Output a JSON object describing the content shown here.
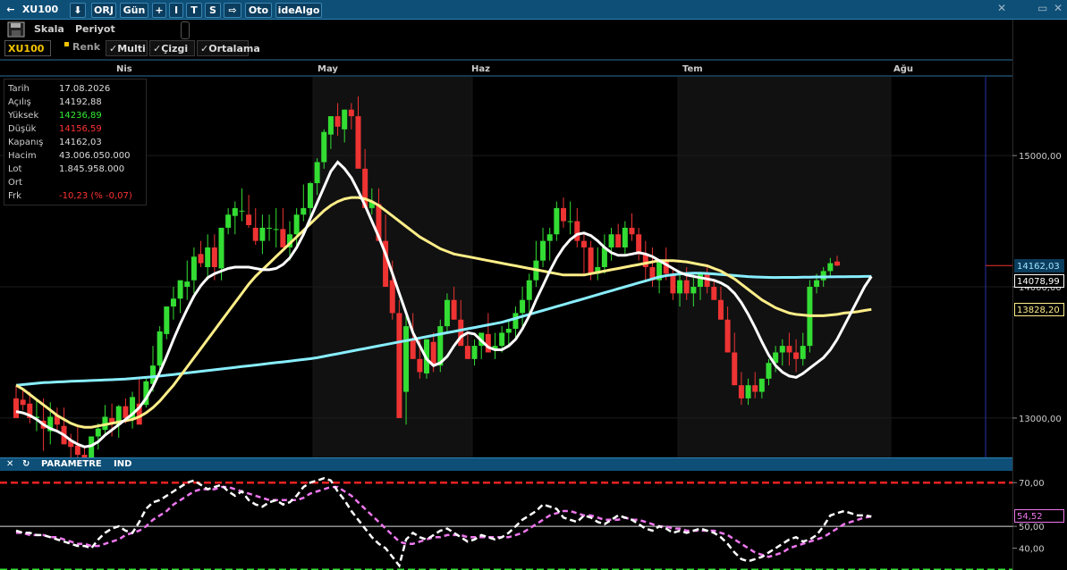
{
  "topbar": {
    "back_arrow": "←",
    "symbol": "XU100",
    "download_icon": "⬇",
    "buttons": [
      "ORJ",
      "Gün",
      "+",
      "I",
      "T",
      "S",
      "⇨",
      "Oto",
      "ideAlgo"
    ],
    "pin": "✕",
    "minimize": "▭",
    "close": "✕"
  },
  "toolbar": {
    "skala": "Skala",
    "periyot": "Periyot",
    "symbol_field": "XU100",
    "renk": "Renk",
    "multi": "✓Multi",
    "cizgi": "✓Çizgi",
    "ortalama": "✓Ortalama"
  },
  "months": [
    "Nis",
    "May",
    "Haz",
    "Tem",
    "Ağu"
  ],
  "info": {
    "rows": [
      {
        "k": "Tarih",
        "v": "17.08.2026",
        "color": "#dddddd"
      },
      {
        "k": "Açılış",
        "v": "14192,88",
        "color": "#dddddd"
      },
      {
        "k": "Yüksek",
        "v": "14236,89",
        "color": "#33ee33"
      },
      {
        "k": "Düşük",
        "v": "14156,59",
        "color": "#ff3333"
      },
      {
        "k": "Kapanış",
        "v": "14162,03",
        "color": "#dddddd"
      },
      {
        "k": "Hacim",
        "v": "43.006.050.000",
        "color": "#dddddd"
      },
      {
        "k": "Lot",
        "v": "1.845.958.000",
        "color": "#dddddd"
      },
      {
        "k": "Ort",
        "v": "",
        "color": "#dddddd"
      },
      {
        "k": "Frk",
        "v": "-10,23 (% -0,07)",
        "color": "#ff3333"
      }
    ]
  },
  "price_axis": {
    "ticks": [
      "15000,00",
      "14000,00",
      "13000,00"
    ],
    "tags": [
      {
        "text": "14162,03",
        "bg": "#0b3d5e",
        "fg": "#9fe6ff",
        "border": "#0b3d5e"
      },
      {
        "text": "14078,99",
        "bg": "#000000",
        "fg": "#ffffff",
        "border": "#ffffff"
      },
      {
        "text": "13828,20",
        "bg": "#000000",
        "fg": "#ffee88",
        "border": "#ffee88"
      }
    ]
  },
  "indicator": {
    "close": "✕",
    "refresh": "↻",
    "parametre": "PARAMETRE",
    "ind": "IND",
    "ticks": [
      "70,00",
      "50,00",
      "40,00"
    ],
    "tag": "54,52"
  },
  "colors": {
    "up": "#33dd33",
    "down": "#ee3333",
    "ma_fast": "#ffffff",
    "ma_mid": "#ffee88",
    "ma_slow": "#88eeff",
    "rsi": "#ffffff",
    "rsi_ma": "#ee77ee",
    "upper_band": "#ee2222",
    "lower_band": "#33dd33"
  },
  "chart_data": {
    "type": "candlestick",
    "ylim": [
      12700,
      15600
    ],
    "candles": [
      [
        13150,
        13240,
        13100,
        13000
      ],
      [
        13140,
        13210,
        13060,
        13100
      ],
      [
        13110,
        13200,
        12960,
        13000
      ],
      [
        13000,
        13150,
        12900,
        13010
      ],
      [
        12980,
        13150,
        12750,
        12920
      ],
      [
        12900,
        13120,
        12800,
        13010
      ],
      [
        13020,
        13080,
        12900,
        12950
      ],
      [
        12940,
        13080,
        12800,
        12800
      ],
      [
        12830,
        12880,
        12680,
        12780
      ],
      [
        12790,
        12950,
        12700,
        12720
      ],
      [
        12720,
        12780,
        12660,
        12700
      ],
      [
        12680,
        12860,
        12660,
        12860
      ],
      [
        12860,
        12960,
        12760,
        12920
      ],
      [
        12910,
        13100,
        12860,
        13010
      ],
      [
        13000,
        13110,
        12860,
        12960
      ],
      [
        12950,
        13100,
        12850,
        13090
      ],
      [
        13090,
        13150,
        12960,
        13000
      ],
      [
        13000,
        13200,
        12920,
        13160
      ],
      [
        13110,
        13300,
        13000,
        12950
      ],
      [
        13100,
        13300,
        13080,
        13280
      ],
      [
        13260,
        13550,
        13200,
        13400
      ],
      [
        13400,
        13700,
        13350,
        13660
      ],
      [
        13640,
        13850,
        13600,
        13850
      ],
      [
        13850,
        14000,
        13750,
        13910
      ],
      [
        13910,
        14000,
        13800,
        14050
      ],
      [
        14000,
        14200,
        13900,
        14040
      ],
      [
        14050,
        14300,
        13950,
        14230
      ],
      [
        14250,
        14350,
        14150,
        14180
      ],
      [
        14150,
        14400,
        14050,
        14300
      ],
      [
        14300,
        14400,
        14050,
        14150
      ],
      [
        14140,
        14200,
        14050,
        14450
      ],
      [
        14450,
        14600,
        14400,
        14550
      ],
      [
        14540,
        14650,
        14400,
        14600
      ],
      [
        14580,
        14750,
        14500,
        14580
      ],
      [
        14550,
        14700,
        14450,
        14470
      ],
      [
        14450,
        14600,
        14320,
        14350
      ],
      [
        14350,
        14550,
        14250,
        14450
      ],
      [
        14450,
        14550,
        14350,
        14450
      ],
      [
        14440,
        14600,
        14300,
        14440
      ],
      [
        14440,
        14600,
        14300,
        14300
      ],
      [
        14300,
        14500,
        14200,
        14400
      ],
      [
        14400,
        14600,
        14300,
        14550
      ],
      [
        14550,
        14780,
        14500,
        14600
      ],
      [
        14600,
        14800,
        14500,
        14790
      ],
      [
        14790,
        14980,
        14700,
        14950
      ],
      [
        14950,
        15200,
        14900,
        15180
      ],
      [
        15160,
        15300,
        15050,
        15300
      ],
      [
        15300,
        15400,
        15150,
        15220
      ],
      [
        15200,
        15350,
        15100,
        15350
      ],
      [
        15350,
        15400,
        15200,
        15300
      ],
      [
        15300,
        15450,
        15100,
        14900
      ],
      [
        14900,
        15050,
        14600,
        14600
      ],
      [
        14600,
        14750,
        14550,
        14650
      ],
      [
        14630,
        14750,
        14450,
        14350
      ],
      [
        14350,
        14550,
        14250,
        14000
      ],
      [
        14050,
        14200,
        13750,
        13800
      ],
      [
        13800,
        13900,
        13000,
        13000
      ],
      [
        13200,
        13800,
        12950,
        13700
      ],
      [
        13600,
        13800,
        13450,
        13450
      ],
      [
        13450,
        13600,
        13300,
        13350
      ],
      [
        13340,
        13600,
        13300,
        13600
      ],
      [
        13580,
        13650,
        13350,
        13400
      ],
      [
        13400,
        13750,
        13350,
        13700
      ],
      [
        13700,
        13950,
        13650,
        13900
      ],
      [
        13900,
        14000,
        13750,
        13750
      ],
      [
        13750,
        13900,
        13550,
        13550
      ],
      [
        13550,
        13650,
        13450,
        13450
      ],
      [
        13450,
        13600,
        13400,
        13550
      ],
      [
        13550,
        13650,
        13450,
        13650
      ],
      [
        13640,
        13800,
        13500,
        13500
      ],
      [
        13520,
        13650,
        13450,
        13550
      ],
      [
        13550,
        13700,
        13500,
        13650
      ],
      [
        13650,
        13750,
        13550,
        13680
      ],
      [
        13680,
        13850,
        13600,
        13800
      ],
      [
        13800,
        14000,
        13700,
        13900
      ],
      [
        13900,
        14100,
        13800,
        14050
      ],
      [
        14050,
        14350,
        14000,
        14200
      ],
      [
        14200,
        14450,
        14150,
        14350
      ],
      [
        14350,
        14450,
        14200,
        14400
      ],
      [
        14400,
        14650,
        14350,
        14600
      ],
      [
        14600,
        14680,
        14450,
        14500
      ],
      [
        14500,
        14650,
        14400,
        14500
      ],
      [
        14500,
        14600,
        14300,
        14350
      ],
      [
        14350,
        14400,
        14100,
        14300
      ],
      [
        14300,
        14350,
        14050,
        14100
      ],
      [
        14100,
        14300,
        14050,
        14150
      ],
      [
        14150,
        14400,
        14100,
        14300
      ],
      [
        14300,
        14450,
        14200,
        14400
      ],
      [
        14400,
        14480,
        14300,
        14300
      ],
      [
        14300,
        14500,
        14250,
        14450
      ],
      [
        14450,
        14560,
        14350,
        14400
      ],
      [
        14400,
        14450,
        14200,
        14250
      ],
      [
        14250,
        14350,
        14050,
        14150
      ],
      [
        14150,
        14300,
        14000,
        14050
      ],
      [
        14050,
        14200,
        13950,
        14200
      ],
      [
        14200,
        14300,
        14050,
        14100
      ],
      [
        14100,
        14150,
        13900,
        13950
      ],
      [
        13950,
        14100,
        13850,
        14050
      ],
      [
        14050,
        14150,
        13900,
        13950
      ],
      [
        13950,
        14100,
        13850,
        14000
      ],
      [
        14000,
        14100,
        13900,
        14100
      ],
      [
        14100,
        14150,
        13950,
        14000
      ],
      [
        14000,
        14050,
        13900,
        13900
      ],
      [
        13900,
        14000,
        13750,
        13750
      ],
      [
        13750,
        13850,
        13550,
        13500
      ],
      [
        13500,
        13650,
        13350,
        13250
      ],
      [
        13250,
        13350,
        13100,
        13150
      ],
      [
        13150,
        13300,
        13100,
        13250
      ],
      [
        13250,
        13350,
        13150,
        13200
      ],
      [
        13200,
        13300,
        13150,
        13300
      ],
      [
        13300,
        13450,
        13250,
        13420
      ],
      [
        13420,
        13550,
        13350,
        13500
      ],
      [
        13500,
        13600,
        13400,
        13550
      ],
      [
        13550,
        13650,
        13400,
        13500
      ],
      [
        13500,
        13600,
        13350,
        13450
      ],
      [
        13450,
        13650,
        13400,
        13550
      ],
      [
        13550,
        14050,
        13500,
        14000
      ],
      [
        14000,
        14100,
        13950,
        14050
      ],
      [
        14050,
        14150,
        14000,
        14120
      ],
      [
        14120,
        14220,
        14080,
        14180
      ],
      [
        14192.88,
        14236.89,
        14156.59,
        14162.03
      ]
    ],
    "ma_fast": [
      13050,
      13040,
      13020,
      12990,
      12950,
      12920,
      12900,
      12870,
      12830,
      12800,
      12780,
      12790,
      12820,
      12870,
      12910,
      12950,
      12990,
      13030,
      13080,
      13150,
      13240,
      13350,
      13470,
      13600,
      13720,
      13830,
      13930,
      14010,
      14070,
      14100,
      14120,
      14140,
      14150,
      14150,
      14150,
      14140,
      14130,
      14130,
      14140,
      14170,
      14220,
      14300,
      14400,
      14520,
      14640,
      14760,
      14880,
      14950,
      14900,
      14830,
      14730,
      14620,
      14500,
      14380,
      14250,
      14100,
      13950,
      13800,
      13650,
      13550,
      13450,
      13400,
      13420,
      13470,
      13550,
      13620,
      13650,
      13640,
      13590,
      13540,
      13520,
      13520,
      13550,
      13600,
      13680,
      13780,
      13900,
      14010,
      14120,
      14220,
      14300,
      14360,
      14400,
      14410,
      14390,
      14350,
      14300,
      14260,
      14240,
      14240,
      14250,
      14260,
      14250,
      14230,
      14200,
      14170,
      14140,
      14110,
      14090,
      14080,
      14070,
      14060,
      14050,
      14030,
      14000,
      13950,
      13880,
      13790,
      13690,
      13580,
      13480,
      13400,
      13350,
      13320,
      13310,
      13340,
      13380,
      13420,
      13460,
      13520,
      13600,
      13700,
      13800,
      13900,
      14000,
      14079
    ],
    "ma_mid": [
      13250,
      13220,
      13180,
      13140,
      13100,
      13060,
      13020,
      12990,
      12960,
      12940,
      12930,
      12930,
      12940,
      12950,
      12960,
      12970,
      12980,
      12990,
      13010,
      13040,
      13080,
      13130,
      13190,
      13250,
      13320,
      13390,
      13460,
      13530,
      13600,
      13670,
      13740,
      13810,
      13880,
      13950,
      14020,
      14080,
      14130,
      14180,
      14230,
      14280,
      14330,
      14380,
      14430,
      14480,
      14530,
      14580,
      14620,
      14650,
      14670,
      14680,
      14680,
      14670,
      14650,
      14620,
      14580,
      14540,
      14500,
      14460,
      14420,
      14380,
      14350,
      14320,
      14290,
      14270,
      14250,
      14240,
      14230,
      14220,
      14210,
      14200,
      14190,
      14180,
      14170,
      14160,
      14150,
      14140,
      14130,
      14120,
      14110,
      14100,
      14090,
      14090,
      14090,
      14090,
      14100,
      14110,
      14120,
      14130,
      14140,
      14150,
      14160,
      14170,
      14180,
      14190,
      14200,
      14200,
      14200,
      14195,
      14190,
      14180,
      14170,
      14160,
      14140,
      14120,
      14090,
      14060,
      14020,
      13980,
      13940,
      13900,
      13870,
      13840,
      13820,
      13800,
      13790,
      13785,
      13780,
      13780,
      13780,
      13785,
      13790,
      13800,
      13805,
      13810,
      13820,
      13828
    ],
    "ma_slow": [
      13250,
      13255,
      13260,
      13265,
      13270,
      13272,
      13275,
      13277,
      13280,
      13282,
      13284,
      13286,
      13288,
      13290,
      13292,
      13295,
      13298,
      13302,
      13306,
      13310,
      13315,
      13320,
      13326,
      13332,
      13338,
      13344,
      13350,
      13356,
      13362,
      13368,
      13374,
      13380,
      13386,
      13392,
      13398,
      13404,
      13410,
      13416,
      13422,
      13428,
      13434,
      13440,
      13446,
      13452,
      13460,
      13470,
      13480,
      13490,
      13500,
      13510,
      13520,
      13530,
      13540,
      13550,
      13560,
      13570,
      13580,
      13590,
      13600,
      13610,
      13620,
      13630,
      13640,
      13650,
      13660,
      13670,
      13680,
      13690,
      13700,
      13710,
      13720,
      13730,
      13745,
      13760,
      13775,
      13790,
      13805,
      13820,
      13835,
      13850,
      13865,
      13880,
      13895,
      13910,
      13925,
      13940,
      13955,
      13970,
      13985,
      14000,
      14015,
      14030,
      14045,
      14060,
      14075,
      14085,
      14092,
      14098,
      14102,
      14104,
      14104,
      14102,
      14098,
      14094,
      14090,
      14086,
      14082,
      14078,
      14075,
      14073,
      14072,
      14071,
      14072,
      14072,
      14072,
      14073,
      14074,
      14075,
      14075,
      14076,
      14077,
      14077,
      14078,
      14078,
      14079,
      14079
    ],
    "rsi_ylim": [
      30,
      75
    ],
    "rsi_upper": 70,
    "rsi_mid": 50,
    "rsi_lower": 30,
    "rsi": [
      48,
      47,
      47,
      46,
      46,
      45,
      44,
      43,
      42,
      41,
      41,
      40,
      44,
      47,
      49,
      50,
      48,
      47,
      52,
      58,
      61,
      62,
      64,
      66,
      68,
      70,
      71,
      69,
      67,
      68,
      69,
      66,
      64,
      66,
      62,
      60,
      59,
      61,
      62,
      60,
      61,
      64,
      68,
      70,
      71,
      72,
      71,
      66,
      62,
      57,
      53,
      49,
      45,
      42,
      40,
      36,
      32,
      44,
      47,
      45,
      44,
      46,
      48,
      49,
      47,
      45,
      43,
      44,
      46,
      45,
      44,
      45,
      47,
      50,
      53,
      55,
      57,
      60,
      59,
      58,
      54,
      53,
      52,
      55,
      54,
      52,
      51,
      53,
      55,
      54,
      53,
      51,
      49,
      48,
      50,
      49,
      47,
      48,
      47,
      48,
      49,
      48,
      47,
      45,
      42,
      38,
      35,
      34,
      35,
      36,
      38,
      40,
      42,
      44,
      45,
      43,
      44,
      46,
      50,
      55,
      56,
      57,
      56,
      55,
      55,
      54.52
    ],
    "rsi_ma": [
      47,
      47,
      46,
      46,
      46,
      45,
      45,
      44,
      43,
      42,
      42,
      41,
      41,
      42,
      43,
      44,
      46,
      47,
      48,
      50,
      53,
      55,
      57,
      60,
      62,
      64,
      66,
      67,
      67,
      67,
      68,
      68,
      67,
      66,
      65,
      64,
      63,
      62,
      62,
      62,
      62,
      62,
      63,
      65,
      66,
      67,
      68,
      68,
      66,
      64,
      61,
      58,
      55,
      52,
      49,
      46,
      43,
      42,
      42,
      43,
      44,
      45,
      45,
      46,
      46,
      46,
      45,
      45,
      45,
      45,
      45,
      45,
      45,
      46,
      47,
      49,
      51,
      53,
      55,
      56,
      57,
      57,
      56,
      55,
      55,
      54,
      53,
      53,
      53,
      54,
      53,
      53,
      52,
      51,
      50,
      50,
      49,
      49,
      48,
      48,
      48,
      48,
      48,
      47,
      46,
      44,
      42,
      40,
      38,
      37,
      36,
      37,
      38,
      40,
      41,
      42,
      43,
      44,
      45,
      47,
      49,
      51,
      52,
      53,
      54,
      54.52
    ]
  }
}
